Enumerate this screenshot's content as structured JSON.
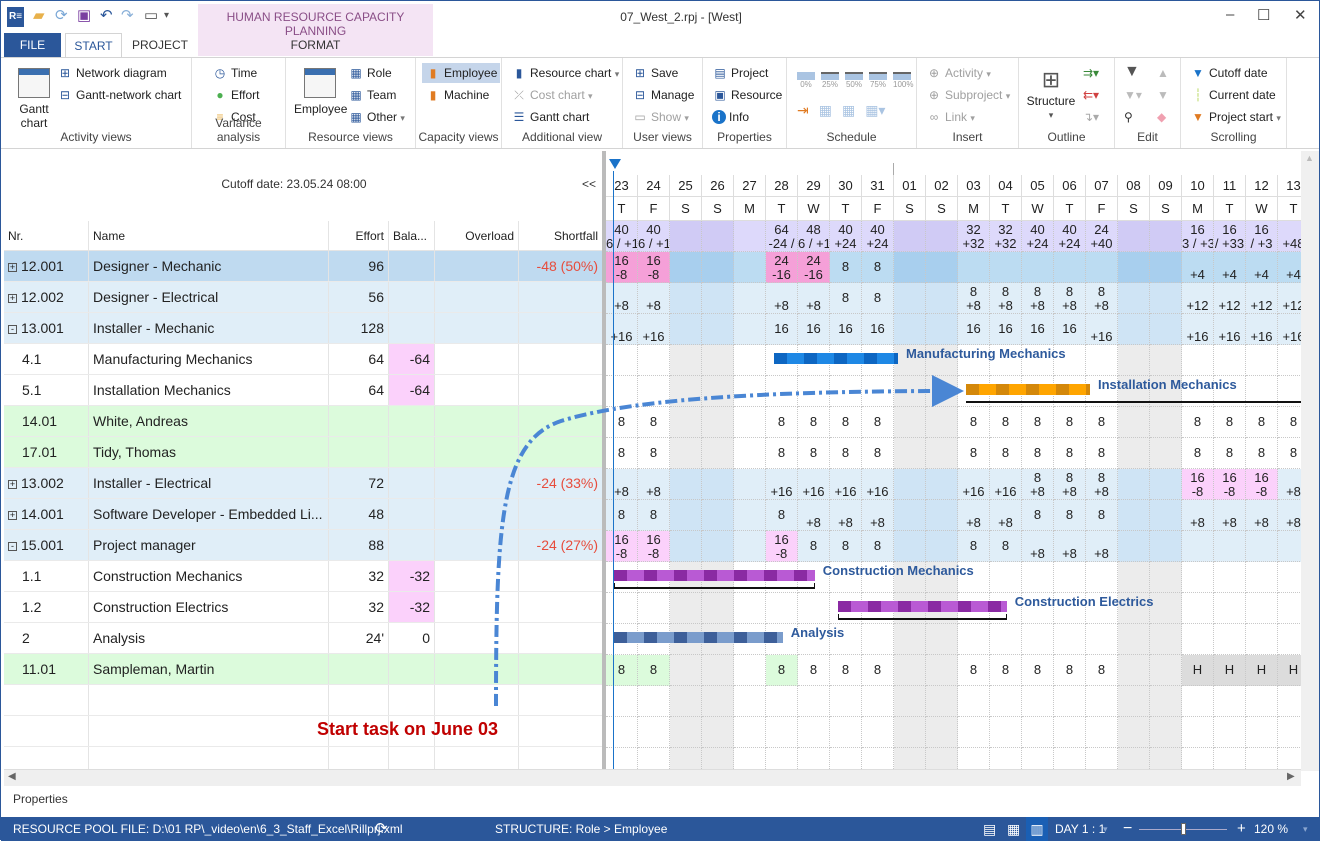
{
  "window": {
    "title": "07_West_2.rpj - [West]",
    "context_tab_group": "HUMAN RESOURCE CAPACITY PLANNING",
    "controls": [
      "minimize",
      "maximize",
      "close"
    ]
  },
  "tabs": [
    {
      "label": "FILE"
    },
    {
      "label": "START",
      "active": true
    },
    {
      "label": "PROJECT"
    },
    {
      "label": "FORMAT"
    }
  ],
  "ribbon": {
    "groups": [
      {
        "label": "Activity views",
        "items": [
          "Gantt chart",
          "Network diagram",
          "Gantt-network chart"
        ]
      },
      {
        "label": "Variance analysis",
        "items": [
          "Time",
          "Effort",
          "Cost"
        ]
      },
      {
        "label": "Resource views",
        "items": [
          "Employee",
          "Role",
          "Team",
          "Other"
        ]
      },
      {
        "label": "Capacity views",
        "items": [
          "Employee",
          "Machine"
        ]
      },
      {
        "label": "Additional view",
        "items": [
          "Resource chart",
          "Cost chart",
          "Gantt chart"
        ]
      },
      {
        "label": "User views",
        "items": [
          "Save",
          "Manage",
          "Show"
        ]
      },
      {
        "label": "Properties",
        "items": [
          "Project",
          "Resource",
          "Info"
        ]
      },
      {
        "label": "Schedule",
        "items": [
          "0%",
          "25%",
          "50%",
          "75%",
          "100%"
        ]
      },
      {
        "label": "Insert",
        "items": [
          "Activity",
          "Subproject",
          "Link"
        ]
      },
      {
        "label": "Outline",
        "items": [
          "Structure"
        ]
      },
      {
        "label": "Edit",
        "items": []
      },
      {
        "label": "Scrolling",
        "items": [
          "Cutoff date",
          "Current date",
          "Project start"
        ]
      }
    ]
  },
  "left_panel": {
    "cutoff": "Cutoff date: 23.05.24 08:00",
    "collapse": "<<",
    "columns": [
      "Nr.",
      "Name",
      "Effort",
      "Bala...",
      "Overload",
      "Shortfall"
    ],
    "rows": [
      {
        "nr": "12.001",
        "name": "Designer - Mechanic",
        "effort": "96",
        "balance": "",
        "overload": "",
        "shortfall": "-48 (50%)",
        "type": "sel",
        "exp": "+"
      },
      {
        "nr": "12.002",
        "name": "Designer - Electrical",
        "effort": "56",
        "balance": "",
        "overload": "",
        "shortfall": "",
        "type": "grp",
        "exp": "+"
      },
      {
        "nr": "13.001",
        "name": "Installer - Mechanic",
        "effort": "128",
        "balance": "",
        "overload": "",
        "shortfall": "",
        "type": "grp",
        "exp": "-"
      },
      {
        "nr": "4.1",
        "name": "Manufacturing Mechanics",
        "effort": "64",
        "balance": "-64",
        "overload": "",
        "shortfall": "",
        "type": "task",
        "exp": ""
      },
      {
        "nr": "5.1",
        "name": "Installation Mechanics",
        "effort": "64",
        "balance": "-64",
        "overload": "",
        "shortfall": "",
        "type": "task",
        "exp": ""
      },
      {
        "nr": "14.01",
        "name": "White, Andreas",
        "effort": "",
        "balance": "",
        "overload": "",
        "shortfall": "",
        "type": "res",
        "exp": ""
      },
      {
        "nr": "17.01",
        "name": "Tidy, Thomas",
        "effort": "",
        "balance": "",
        "overload": "",
        "shortfall": "",
        "type": "res",
        "exp": ""
      },
      {
        "nr": "13.002",
        "name": "Installer - Electrical",
        "effort": "72",
        "balance": "",
        "overload": "",
        "shortfall": "-24 (33%)",
        "type": "grp",
        "exp": "+"
      },
      {
        "nr": "14.001",
        "name": "Software Developer - Embedded Li...",
        "effort": "48",
        "balance": "",
        "overload": "",
        "shortfall": "",
        "type": "grp",
        "exp": "+"
      },
      {
        "nr": "15.001",
        "name": "Project manager",
        "effort": "88",
        "balance": "",
        "overload": "",
        "shortfall": "-24 (27%)",
        "type": "grp",
        "exp": "-"
      },
      {
        "nr": "1.1",
        "name": "Construction Mechanics",
        "effort": "32",
        "balance": "-32",
        "overload": "",
        "shortfall": "",
        "type": "task",
        "exp": ""
      },
      {
        "nr": "1.2",
        "name": "Construction Electrics",
        "effort": "32",
        "balance": "-32",
        "overload": "",
        "shortfall": "",
        "type": "task",
        "exp": ""
      },
      {
        "nr": "2",
        "name": "Analysis",
        "effort": "24'",
        "balance": "0",
        "overload": "",
        "shortfall": "",
        "type": "task",
        "exp": ""
      },
      {
        "nr": "11.01",
        "name": "Sampleman, Martin",
        "effort": "",
        "balance": "",
        "overload": "",
        "shortfall": "",
        "type": "res",
        "exp": ""
      }
    ],
    "annotation": "Start task on June 03"
  },
  "timeline": {
    "days": [
      "23",
      "24",
      "25",
      "26",
      "27",
      "28",
      "29",
      "30",
      "31",
      "01",
      "02",
      "03",
      "04",
      "05",
      "06",
      "07",
      "08",
      "09",
      "10",
      "11",
      "12",
      "13"
    ],
    "weekdays": [
      "T",
      "F",
      "S",
      "S",
      "M",
      "T",
      "W",
      "T",
      "F",
      "S",
      "S",
      "M",
      "T",
      "W",
      "T",
      "F",
      "S",
      "S",
      "M",
      "T",
      "W",
      "T"
    ],
    "weekend_idx": [
      2,
      3,
      9,
      10,
      16,
      17
    ],
    "summary_row": [
      "40\n6 / +1",
      "40\n6 / +1",
      "",
      "",
      "",
      "64\n-24 /",
      "48\n6 / +1",
      "40\n+24",
      "40\n+24",
      "",
      "",
      "32\n+32",
      "32\n+32",
      "40\n+24",
      "40\n+24",
      "24\n+40",
      "",
      "",
      "16\n3 / +33",
      "16\n/ +33",
      "16\n/ +3",
      "\n+48"
    ],
    "rows": [
      [
        "16\n-8",
        "16\n-8",
        "",
        "",
        "",
        "24\n-16",
        "24\n-16",
        "8",
        "8",
        "",
        "",
        "",
        "",
        "",
        "",
        "",
        "",
        "",
        "\n+4",
        "\n+4",
        "\n+4",
        "\n+4"
      ],
      [
        "\n+8",
        "\n+8",
        "",
        "",
        "",
        "\n+8",
        "\n+8",
        "8",
        "8",
        "",
        "",
        "8\n+8",
        "8\n+8",
        "8\n+8",
        "8\n+8",
        "8\n+8",
        "",
        "",
        "\n+12",
        "\n+12",
        "\n+12",
        "\n+12"
      ],
      [
        "\n+16",
        "\n+16",
        "",
        "",
        "",
        "16",
        "16",
        "16",
        "16",
        "",
        "",
        "16",
        "16",
        "16",
        "16",
        "\n+16",
        "",
        "",
        "\n+16",
        "\n+16",
        "\n+16",
        "\n+16"
      ],
      null,
      null,
      [
        "8",
        "8",
        "",
        "",
        "",
        "8",
        "8",
        "8",
        "8",
        "",
        "",
        "8",
        "8",
        "8",
        "8",
        "8",
        "",
        "",
        "8",
        "8",
        "8",
        "8"
      ],
      [
        "8",
        "8",
        "",
        "",
        "",
        "8",
        "8",
        "8",
        "8",
        "",
        "",
        "8",
        "8",
        "8",
        "8",
        "8",
        "",
        "",
        "8",
        "8",
        "8",
        "8"
      ],
      [
        "\n+8",
        "\n+8",
        "",
        "",
        "",
        "\n+16",
        "\n+16",
        "\n+16",
        "\n+16",
        "",
        "",
        "\n+16",
        "\n+16",
        "8\n+8",
        "8\n+8",
        "8\n+8",
        "",
        "",
        "16\n-8",
        "16\n-8",
        "16\n-8",
        "\n+8"
      ],
      [
        "8",
        "8",
        "",
        "",
        "",
        "8",
        "\n+8",
        "\n+8",
        "\n+8",
        "",
        "",
        "\n+8",
        "\n+8",
        "8",
        "8",
        "8",
        "",
        "",
        "\n+8",
        "\n+8",
        "\n+8",
        "\n+8"
      ],
      [
        "16\n-8",
        "16\n-8",
        "",
        "",
        "",
        "16\n-8",
        "8",
        "8",
        "8",
        "",
        "",
        "8",
        "8",
        "\n+8",
        "\n+8",
        "\n+8",
        "",
        "",
        "",
        "",
        "",
        ""
      ],
      null,
      null,
      null,
      [
        "8",
        "8",
        "",
        "",
        "",
        "8",
        "8",
        "8",
        "8",
        "",
        "",
        "8",
        "8",
        "8",
        "8",
        "8",
        "",
        "",
        "H",
        "H",
        "H",
        "H"
      ]
    ],
    "bars": [
      {
        "row": 3,
        "start": 5,
        "end": 9,
        "label": "Manufacturing Mechanics",
        "color": "#1e88e5",
        "dark": "#0d66c2"
      },
      {
        "row": 4,
        "start": 11,
        "end": 15,
        "label": "Installation Mechanics",
        "color": "#ffa500",
        "dark": "#d4880a"
      },
      {
        "row": 10,
        "start": 0,
        "end": 6.4,
        "label": "Construction Mechanics",
        "color": "#b95ad4",
        "dark": "#8a2aa3"
      },
      {
        "row": 11,
        "start": 7,
        "end": 12.4,
        "label": "Construction Electrics",
        "color": "#b95ad4",
        "dark": "#8a2aa3"
      },
      {
        "row": 12,
        "start": 0,
        "end": 5.4,
        "label": "Analysis",
        "color": "#7a9ccc",
        "dark": "#3d5f99"
      }
    ]
  },
  "properties_label": "Properties",
  "status": {
    "pool_file": "RESOURCE POOL FILE: D:\\01 RP\\_video\\en\\6_3_Staff_Excel\\Rillprj.xml",
    "structure": "STRUCTURE: Role > Employee",
    "scale": "DAY 1 : 1",
    "zoom": "120 %",
    "zoom_level": 0.5
  }
}
